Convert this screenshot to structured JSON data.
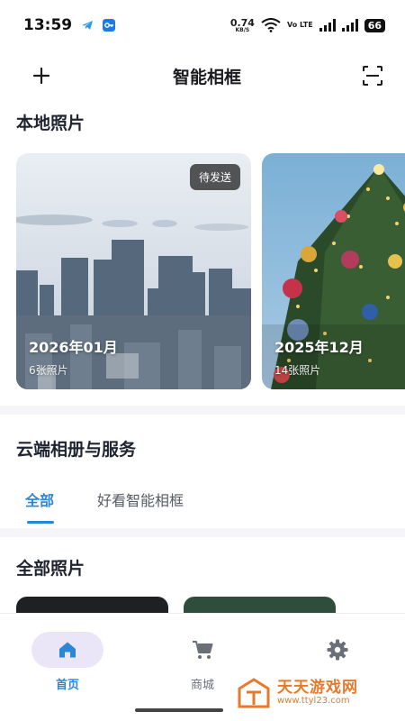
{
  "status_bar": {
    "time": "13:59",
    "net_speed_value": "0.74",
    "net_speed_unit": "KB/S",
    "network_label": "Vo LTE",
    "battery": "66"
  },
  "header": {
    "title": "智能相框",
    "add_icon": "plus-icon",
    "scan_icon": "scan-icon"
  },
  "local_photos": {
    "title": "本地照片",
    "albums": [
      {
        "name": "2026年01月",
        "count": "6张照片",
        "badge": "待发送",
        "theme": "city-skyline"
      },
      {
        "name": "2025年12月",
        "count": "14张照片",
        "badge": "",
        "theme": "christmas-tree"
      }
    ]
  },
  "cloud": {
    "title": "云端相册与服务",
    "tabs": [
      {
        "label": "全部",
        "active": true
      },
      {
        "label": "好看智能相框",
        "active": false
      }
    ]
  },
  "all_photos": {
    "title": "全部照片"
  },
  "bottom_nav": {
    "items": [
      {
        "label": "首页",
        "icon": "home-icon",
        "active": true
      },
      {
        "label": "商城",
        "icon": "cart-icon",
        "active": false
      },
      {
        "label": "",
        "icon": "gear-icon",
        "active": false
      }
    ]
  },
  "watermark": {
    "main": "天天游戏网",
    "sub": "www.ttyl23.com"
  },
  "colors": {
    "accent": "#2a86d6",
    "active_pill": "#ebe5f8",
    "watermark": "#e8792b"
  }
}
